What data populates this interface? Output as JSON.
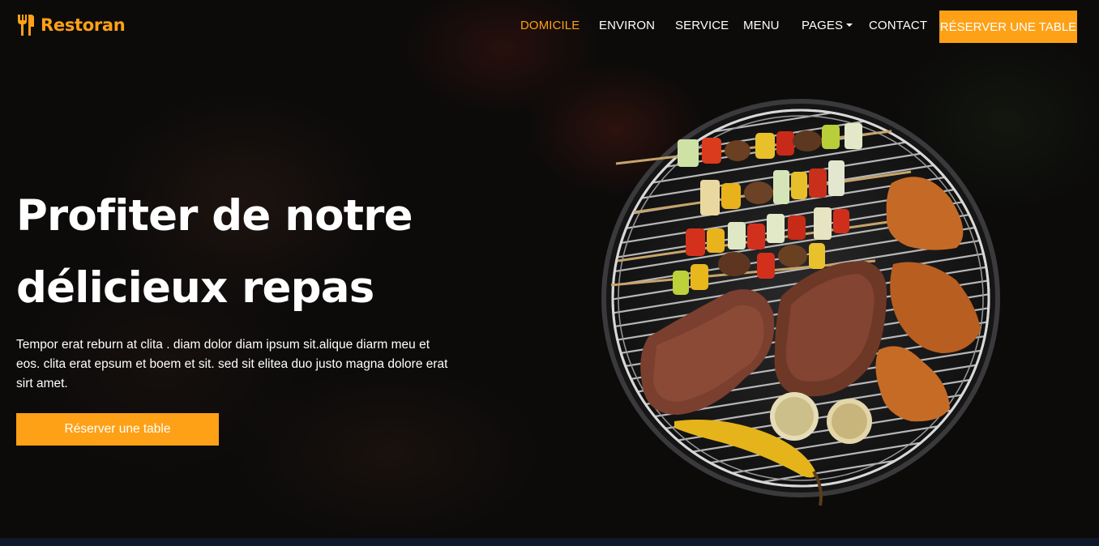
{
  "brand": {
    "name": "Restoran",
    "icon": "utensils-icon",
    "accent": "#fea116"
  },
  "nav": {
    "items": [
      {
        "label": "DOMICILE",
        "active": true
      },
      {
        "label": "ENVIRON",
        "active": false
      },
      {
        "label": "SERVICE",
        "active": false
      },
      {
        "label": "MENU",
        "active": false
      },
      {
        "label": "PAGES",
        "active": false,
        "dropdown": true
      },
      {
        "label": "CONTACT",
        "active": false
      }
    ],
    "cta": "RÉSERVER UNE TABLE"
  },
  "hero": {
    "title_line1": "Profiter de notre",
    "title_line2": "délicieux repas",
    "description": "Tempor erat reburn at clita . diam dolor diam ipsum sit.alique diarm meu et eos. clita erat epsum et boem et sit. sed sit elitea duo justo magna dolore erat sirt amet.",
    "button": "Réserver une table",
    "image": "grilled-food-on-barbecue"
  },
  "colors": {
    "primary": "#fea116",
    "dark": "#0f172b"
  }
}
